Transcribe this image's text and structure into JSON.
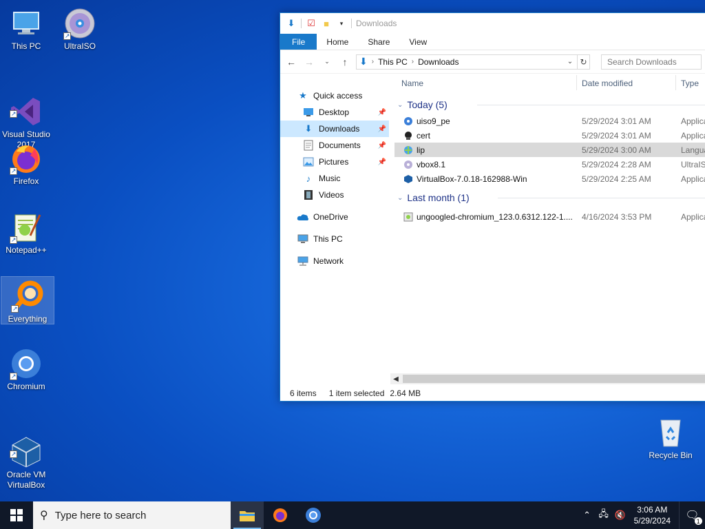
{
  "desktop": {
    "icons": [
      {
        "label": "This PC"
      },
      {
        "label": "UltraISO"
      },
      {
        "label": "Visual Studio\n2017"
      },
      {
        "label": "Firefox"
      },
      {
        "label": "Notepad++"
      },
      {
        "label": "Everything"
      },
      {
        "label": "Chromium"
      },
      {
        "label": "Oracle VM\nVirtualBox"
      },
      {
        "label": "Recycle Bin"
      }
    ]
  },
  "explorer": {
    "title": "Downloads",
    "ribbon_tabs": [
      "File",
      "Home",
      "Share",
      "View"
    ],
    "address": {
      "root": "This PC",
      "current": "Downloads"
    },
    "search_placeholder": "Search Downloads",
    "nav": [
      {
        "label": "Quick access",
        "icon": "star-icon"
      },
      {
        "label": "Desktop",
        "icon": "desktop-folder-icon",
        "pinned": true
      },
      {
        "label": "Downloads",
        "icon": "downloads-folder-icon",
        "pinned": true,
        "selected": true
      },
      {
        "label": "Documents",
        "icon": "documents-folder-icon",
        "pinned": true
      },
      {
        "label": "Pictures",
        "icon": "pictures-folder-icon",
        "pinned": true
      },
      {
        "label": "Music",
        "icon": "music-folder-icon"
      },
      {
        "label": "Videos",
        "icon": "videos-folder-icon"
      },
      {
        "label": "OneDrive",
        "icon": "cloud-icon"
      },
      {
        "label": "This PC",
        "icon": "computer-icon"
      },
      {
        "label": "Network",
        "icon": "network-icon"
      }
    ],
    "columns": {
      "name": "Name",
      "date": "Date modified",
      "type": "Type"
    },
    "groups": [
      {
        "label": "Today (5)",
        "files": [
          {
            "name": "uiso9_pe",
            "date": "5/29/2024 3:01 AM",
            "type": "Applica",
            "icon": "installer-icon"
          },
          {
            "name": "cert",
            "date": "5/29/2024 3:01 AM",
            "type": "Applica",
            "icon": "certificate-app-icon"
          },
          {
            "name": "lip",
            "date": "5/29/2024 3:00 AM",
            "type": "Langua",
            "icon": "language-pack-icon",
            "selected": true
          },
          {
            "name": "vbox8.1",
            "date": "5/29/2024 2:28 AM",
            "type": "UltraIS",
            "icon": "disc-image-icon"
          },
          {
            "name": "VirtualBox-7.0.18-162988-Win",
            "date": "5/29/2024 2:25 AM",
            "type": "Applica",
            "icon": "virtualbox-icon"
          }
        ]
      },
      {
        "label": "Last month (1)",
        "files": [
          {
            "name": "ungoogled-chromium_123.0.6312.122-1....",
            "date": "4/16/2024 3:53 PM",
            "type": "Applica",
            "icon": "installer-icon"
          }
        ]
      }
    ],
    "status": {
      "count": "6 items",
      "selection": "1 item selected",
      "size": "2.64 MB"
    }
  },
  "taskbar": {
    "search_placeholder": "Type here to search",
    "time": "3:06 AM",
    "date": "5/29/2024",
    "notifications": "1"
  },
  "colors": {
    "accent": "#1979ca",
    "selection": "#cce8ff",
    "taskbar": "#101828"
  }
}
